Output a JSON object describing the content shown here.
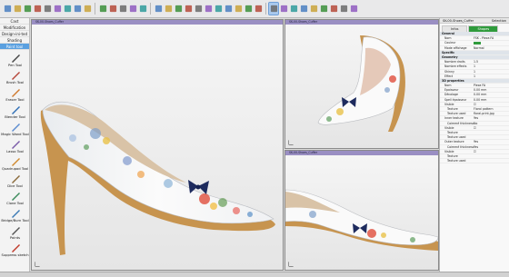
{
  "toolbar": {
    "icons": [
      "new-icon",
      "open-icon",
      "save-icon",
      "save-as-icon",
      "import-icon",
      "export-icon",
      "undo-icon",
      "redo-icon",
      "delete-icon",
      "select-icon",
      "move-icon",
      "rotate-icon",
      "scale-icon",
      "snap-icon",
      "view-front-icon",
      "view-side-icon",
      "view-top-icon",
      "view-persp-icon",
      "shade-icon",
      "wire-icon",
      "light-icon",
      "camera-icon",
      "grid-icon",
      "render-icon",
      "settings-icon",
      "paint-select-icon",
      "fill-icon",
      "text-tool-icon",
      "link-icon",
      "square-icon",
      "rotate-view-icon",
      "layers-icon",
      "frames-icon",
      "help-icon"
    ]
  },
  "left_panel": {
    "modes": [
      "Cast",
      "Modification",
      "Design-ini-ted",
      "Shading",
      "Paint tool"
    ],
    "selected_mode": 4,
    "tools": [
      "Pen Tool",
      "Brush Tool",
      "Eraser Tool",
      "Blender Tool",
      "Magic Wand Tool",
      "Lasso Tool",
      "Quadrupod Tool",
      "Dice Tool",
      "Clone Tool",
      "Bridge/Burn Tool",
      "Points",
      "Suppress sketch"
    ]
  },
  "viewports": [
    {
      "title": "SK-00-Shoes_Cuffer",
      "label": "main-3d-view"
    },
    {
      "title": "SK-00-Shoes_Cuffer",
      "label": "top-right-view"
    },
    {
      "title": "SK-00-Shoes_Cuffer",
      "label": "bottom-right-view"
    }
  ],
  "properties": {
    "title": "SK-00-Shoes_Cuffer",
    "close_label": "×",
    "top_right": "Selection",
    "tabs": [
      "Infos",
      "Shapes"
    ],
    "active_tab": 1,
    "rows": [
      {
        "type": "section",
        "k": "General"
      },
      {
        "type": "row",
        "k": "Nom",
        "v": "FSK - Pieza FA"
      },
      {
        "type": "row",
        "k": "Couleur",
        "v": "color"
      },
      {
        "type": "row",
        "k": "Mode affichage",
        "v": "Normal"
      },
      {
        "type": "section",
        "k": "Specific"
      },
      {
        "type": "section",
        "k": "Geometry"
      },
      {
        "type": "row",
        "k": "Nombre droits",
        "v": "1.5"
      },
      {
        "type": "row",
        "k": "Nombre effects",
        "v": "1"
      },
      {
        "type": "row",
        "k": "Shinny",
        "v": "1"
      },
      {
        "type": "row",
        "k": "Effect",
        "v": "1"
      },
      {
        "type": "section",
        "k": "3D properties"
      },
      {
        "type": "row",
        "k": "Nom",
        "v": "Pieza FA"
      },
      {
        "type": "row",
        "k": "Epaisseur",
        "v": "0.00 mm"
      },
      {
        "type": "row",
        "k": "Décalage",
        "v": "0.00 mm"
      },
      {
        "type": "row",
        "k": "Spell épaisseur",
        "v": "0.00 mm"
      },
      {
        "type": "row",
        "k": "Visible",
        "v": "check"
      },
      {
        "type": "sub",
        "k": "Texture",
        "v": "Floral pattern"
      },
      {
        "type": "sub",
        "k": "Texture used",
        "v": "floral-print.jpg"
      },
      {
        "type": "row",
        "k": "Inner texture",
        "v": "Yes"
      },
      {
        "type": "sub",
        "k": "Coimmé thickness",
        "v": "No"
      },
      {
        "type": "row",
        "k": "Visible",
        "v": "check"
      },
      {
        "type": "sub",
        "k": "Texture",
        "v": ""
      },
      {
        "type": "sub",
        "k": "Texture used",
        "v": ""
      },
      {
        "type": "row",
        "k": "Outer texture",
        "v": "Yes"
      },
      {
        "type": "sub",
        "k": "Coimmé thickness",
        "v": "Yes"
      },
      {
        "type": "row",
        "k": "Visible",
        "v": "check"
      },
      {
        "type": "sub",
        "k": "Texture",
        "v": ""
      },
      {
        "type": "sub",
        "k": "Texture used",
        "v": ""
      }
    ]
  },
  "colors": {
    "accent_active": "#2f9b3c",
    "viewport_title": "#9a8fc3",
    "mode_selected": "#5aa0e0"
  }
}
